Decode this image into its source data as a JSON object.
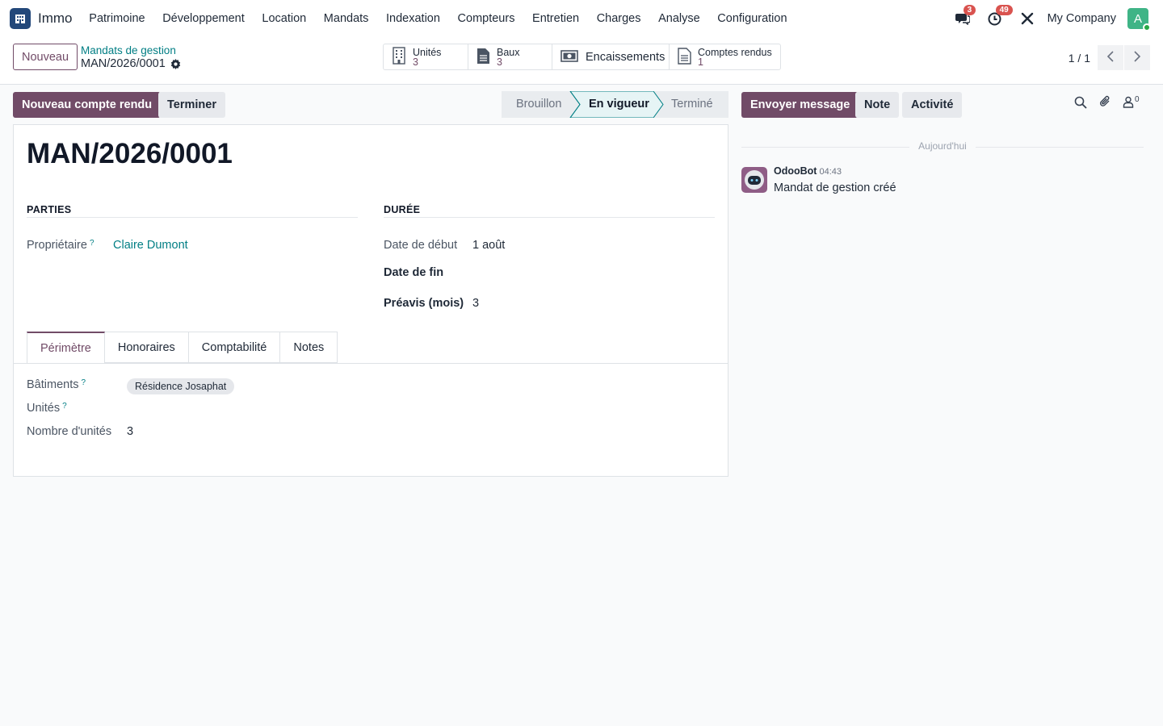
{
  "app": {
    "name": "Immo"
  },
  "menu": [
    "Patrimoine",
    "Développement",
    "Location",
    "Mandats",
    "Indexation",
    "Compteurs",
    "Entretien",
    "Charges",
    "Analyse",
    "Configuration"
  ],
  "systray": {
    "messages_count": "3",
    "activities_count": "49",
    "company": "My Company",
    "avatar_letter": "A"
  },
  "control": {
    "new_label": "Nouveau",
    "breadcrumb_parent": "Mandats de gestion",
    "breadcrumb_current": "MAN/2026/0001",
    "smart_buttons": [
      {
        "label": "Unités",
        "value": "3",
        "icon": "building-icon"
      },
      {
        "label": "Baux",
        "value": "3",
        "icon": "document-icon"
      },
      {
        "label": "Encaissements",
        "icon": "money-icon"
      },
      {
        "label": "Comptes rendus",
        "value": "1",
        "icon": "report-icon"
      }
    ],
    "pager": "1 / 1"
  },
  "statusbar": {
    "primary_label": "Nouveau compte rendu",
    "secondary_label": "Terminer",
    "stages": [
      "Brouillon",
      "En vigueur",
      "Terminé"
    ],
    "active_stage": "En vigueur"
  },
  "form": {
    "title": "MAN/2026/0001",
    "parties": {
      "heading": "PARTIES",
      "owner_label": "Propriétaire",
      "owner_value": "Claire Dumont"
    },
    "duree": {
      "heading": "DURÉE",
      "start_label": "Date de début",
      "start_value": "1 août",
      "end_label": "Date de fin",
      "end_value": "",
      "notice_label": "Préavis (mois)",
      "notice_value": "3"
    },
    "tabs": [
      "Périmètre",
      "Honoraires",
      "Comptabilité",
      "Notes"
    ],
    "perimetre": {
      "buildings_label": "Bâtiments",
      "buildings_tag": "Résidence Josaphat",
      "units_label": "Unités",
      "count_label": "Nombre d'unités",
      "count_value": "3"
    },
    "help_marker": "?"
  },
  "chatter": {
    "send_label": "Envoyer message",
    "note_label": "Note",
    "activity_label": "Activité",
    "followers_count": "0",
    "date_separator": "Aujourd'hui",
    "messages": [
      {
        "author": "OdooBot",
        "time": "04:43",
        "body": "Mandat de gestion créé"
      }
    ]
  },
  "colors": {
    "brand": "#714b67",
    "link": "#017e84",
    "badge": "#d9534f"
  }
}
